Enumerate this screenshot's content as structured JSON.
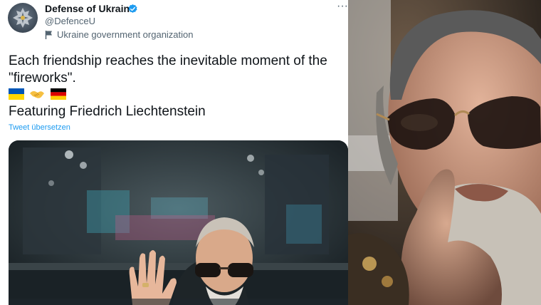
{
  "tweet": {
    "display_name": "Defense of Ukraine",
    "handle": "@DefenceU",
    "label": "Ukraine government organization",
    "text": "Each friendship reaches the inevitable moment of the \"fireworks\".",
    "emojis": [
      "ukraine-flag-emoji",
      "handshake-emoji",
      "germany-flag-emoji"
    ],
    "featuring": "Featuring Friedrich Liechtenstein",
    "translate_link": "Tweet übersetzen",
    "more_label": "···"
  },
  "colors": {
    "text": "#0f1419",
    "secondary": "#536471",
    "accent": "#1d9bf0"
  }
}
